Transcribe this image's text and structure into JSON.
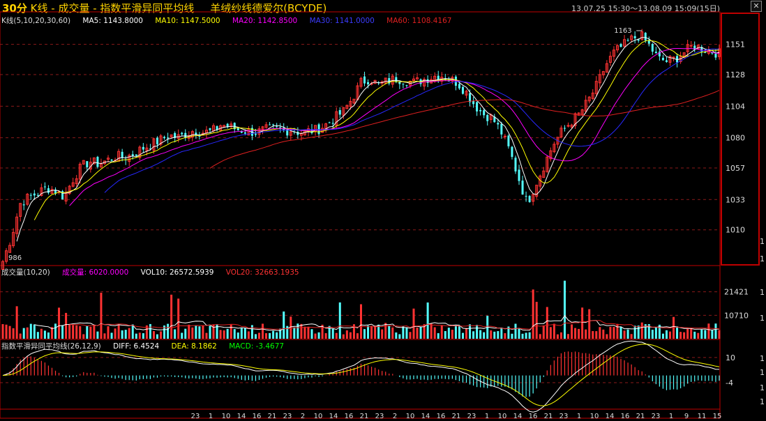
{
  "header": {
    "period": "30分",
    "title": "K线 - 成交量 - 指数平滑异同平均线",
    "stock": "羊绒纱线德爱尔(BCYDE)",
    "range": "13.07.25 15:30～13.08.09 15:09(15日)"
  },
  "legend_k": {
    "label": "K线(5,10,20,30,60)",
    "ma5": "MA5: 1143.8000",
    "ma10": "MA10: 1147.5000",
    "ma20": "MA20: 1142.8500",
    "ma30": "MA30: 1141.0000",
    "ma60": "MA60: 1108.4167"
  },
  "legend_vol": {
    "label": "成交量(10,20)",
    "vol": "成交量: 6020.0000",
    "vol10": "VOL10: 26572.5939",
    "vol20": "VOL20: 32663.1935"
  },
  "legend_macd": {
    "label": "指数平滑异同平均线(26,12,9)",
    "diff": "DIFF: 6.4524",
    "dea": "DEA: 8.1862",
    "macd": "MACD: -3.4677"
  },
  "colors": {
    "up": "#ff3232",
    "down": "#54ffff",
    "ma5": "#ffffff",
    "ma10": "#ffff00",
    "ma20": "#ff00ff",
    "ma30": "#2828ff",
    "ma60": "#e02020",
    "grid": "#8b1a1a",
    "border": "#c00000"
  },
  "chart_data": [
    {
      "type": "candlestick",
      "name": "K线",
      "ylim": [
        986,
        1163
      ],
      "yticks": [
        1010,
        1033,
        1057,
        1080,
        1104,
        1128,
        1151
      ],
      "high_label": "1163",
      "low_label": "986",
      "close_path": [
        986,
        1005,
        1030,
        1035,
        1038,
        1042,
        1040,
        1035,
        1048,
        1058,
        1062,
        1060,
        1063,
        1066,
        1065,
        1068,
        1072,
        1075,
        1078,
        1082,
        1080,
        1083,
        1086,
        1084,
        1085,
        1090,
        1088,
        1086,
        1085,
        1084,
        1086,
        1087,
        1085,
        1086,
        1084,
        1085,
        1086,
        1090,
        1095,
        1100,
        1110,
        1122,
        1125,
        1120,
        1123,
        1125,
        1124,
        1122,
        1124,
        1126,
        1128,
        1125,
        1122,
        1115,
        1105,
        1098,
        1095,
        1085,
        1070,
        1050,
        1030,
        1045,
        1060,
        1075,
        1085,
        1092,
        1098,
        1108,
        1120,
        1135,
        1145,
        1150,
        1155,
        1158,
        1150,
        1140,
        1138,
        1140,
        1145,
        1150,
        1148,
        1146,
        1144
      ]
    },
    {
      "type": "bar",
      "name": "成交量",
      "ylim": [
        0,
        28000
      ],
      "yticks": [
        10710,
        21421
      ]
    },
    {
      "type": "macd",
      "name": "指数平滑异同平均线",
      "ylim": [
        -18,
        15
      ],
      "yticks": [
        -4,
        10
      ]
    }
  ],
  "time_axis": [
    "23",
    "1",
    "10",
    "14",
    "16",
    "21",
    "23",
    "2",
    "10",
    "14",
    "16",
    "21",
    "23",
    "2",
    "10",
    "14",
    "16",
    "21",
    "23",
    "1",
    "10",
    "14",
    "16",
    "21",
    "23",
    "1",
    "10",
    "14",
    "16",
    "21",
    "23",
    "1",
    "9",
    "11",
    "15"
  ],
  "right_axis_ticks": [
    "1",
    "1",
    "1",
    "1",
    "1",
    "1",
    "1",
    "1"
  ]
}
